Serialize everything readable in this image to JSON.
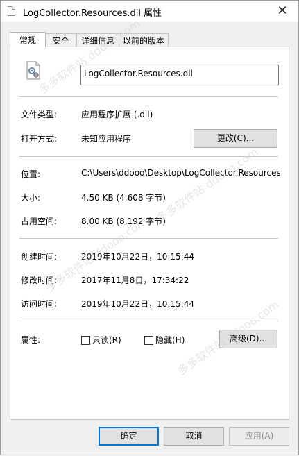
{
  "window": {
    "title": "LogCollector.Resources.dll 属性",
    "close_symbol": "✕"
  },
  "tabs": [
    {
      "label": "常规",
      "active": true
    },
    {
      "label": "安全",
      "active": false
    },
    {
      "label": "详细信息",
      "active": false
    },
    {
      "label": "以前的版本",
      "active": false
    }
  ],
  "general": {
    "filename": "LogCollector.Resources.dll",
    "file_type_label": "文件类型:",
    "file_type_value": "应用程序扩展 (.dll)",
    "opens_with_label": "打开方式:",
    "opens_with_value": "未知应用程序",
    "change_button": "更改(C)...",
    "location_label": "位置:",
    "location_value": "C:\\Users\\ddooo\\Desktop\\LogCollector.Resources",
    "size_label": "大小:",
    "size_value": "4.50 KB (4,608 字节)",
    "size_on_disk_label": "占用空间:",
    "size_on_disk_value": "8.00 KB (8,192 字节)",
    "created_label": "创建时间:",
    "created_value": "2019年10月22日，10:15:44",
    "modified_label": "修改时间:",
    "modified_value": "2017年11月8日，17:34:22",
    "accessed_label": "访问时间:",
    "accessed_value": "2019年10月22日，10:15:44",
    "attributes_label": "属性:",
    "readonly_label": "只读(R)",
    "hidden_label": "隐藏(H)",
    "advanced_button": "高级(D)..."
  },
  "footer": {
    "ok": "确定",
    "cancel": "取消",
    "apply": "应用(A)"
  },
  "watermark_text": "多多软件站 ddooo.com",
  "colors": {
    "accent": "#0078d7",
    "watermark": "#c8c8c8"
  }
}
